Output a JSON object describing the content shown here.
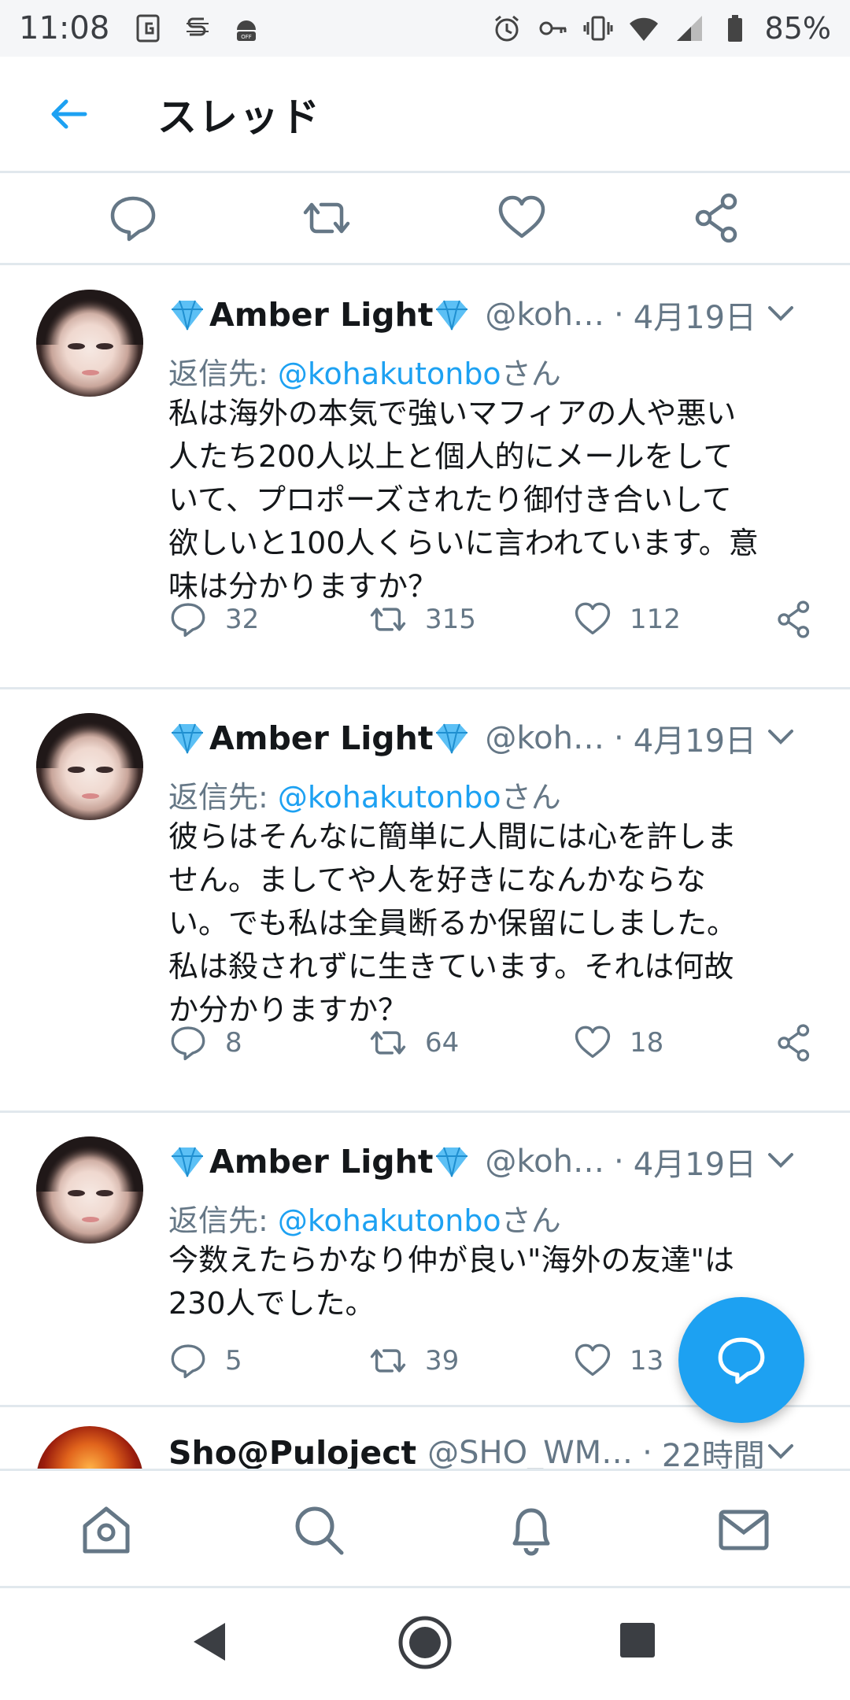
{
  "status_bar": {
    "time": "11:08",
    "battery": "85%"
  },
  "header": {
    "title": "スレッド"
  },
  "tweets": [
    {
      "name": "Amber Light",
      "handle": "@koh…",
      "date": "4月19日",
      "reply_label": "返信先: ",
      "reply_link": "@kohakutonbo",
      "reply_suffix": "さん",
      "text_lines": [
        "私は海外の本気で強いマフィアの人や悪い",
        "人たち200人以上と個人的にメールをして",
        "いて、プロポーズされたり御付き合いして",
        "欲しいと100人くらいに言われています。意",
        "味は分かりますか？"
      ],
      "replies": "32",
      "retweets": "315",
      "likes": "112"
    },
    {
      "name": "Amber Light",
      "handle": "@koh…",
      "date": "4月19日",
      "reply_label": "返信先: ",
      "reply_link": "@kohakutonbo",
      "reply_suffix": "さん",
      "text_lines": [
        "彼らはそんなに簡単に人間には心を許しま",
        "せん。ましてや人を好きになんかならな",
        "い。でも私は全員断るか保留にしました。",
        "私は殺されずに生きています。それは何故",
        "か分かりますか？"
      ],
      "replies": "8",
      "retweets": "64",
      "likes": "18"
    },
    {
      "name": "Amber Light",
      "handle": "@koh…",
      "date": "4月19日",
      "reply_label": "返信先: ",
      "reply_link": "@kohakutonbo",
      "reply_suffix": "さん",
      "text_lines": [
        "今数えたらかなり仲が良い\"海外の友達\"は",
        "230人でした。"
      ],
      "replies": "5",
      "retweets": "39",
      "likes": "13"
    }
  ],
  "next_tweet": {
    "name": "Sho@Puloject",
    "handle": "@SHO_WM…",
    "date": "22時間"
  },
  "colors": {
    "accent": "#1da1f2",
    "muted": "#657786",
    "divider": "#e1e8ed"
  }
}
